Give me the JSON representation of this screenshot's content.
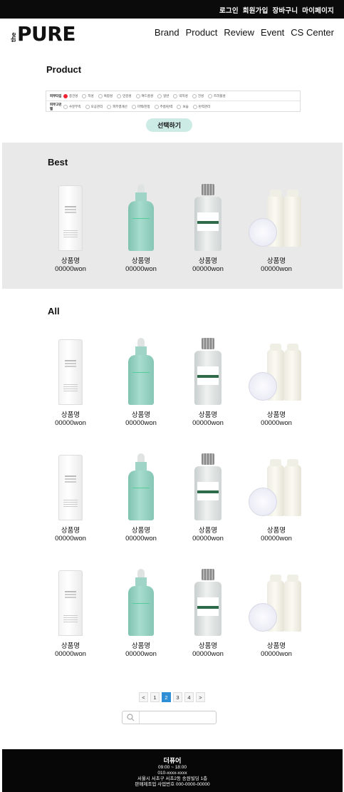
{
  "topbar": {
    "links": [
      "로그인",
      "회원가입",
      "장바구니",
      "마이페이지"
    ]
  },
  "logo": {
    "prefix": "the",
    "name": "PURE"
  },
  "nav": [
    "Brand",
    "Product",
    "Review",
    "Event",
    "CS Center"
  ],
  "product_section": {
    "title": "Product"
  },
  "filter": {
    "row1": {
      "label": "피부타입",
      "options": [
        "중건성",
        "지성",
        "복합성",
        "민감성",
        "여드름성",
        "일반",
        "약지성",
        "건성",
        "트러블성"
      ],
      "selected_index": 0
    },
    "row2": {
      "label": "피부고민별",
      "options": [
        "수분부족",
        "모공관리",
        "피부결개선",
        "미백/진정",
        "주름/탄력",
        "보습",
        "탄력관리"
      ]
    }
  },
  "select_button": "선택하기",
  "best": {
    "title": "Best",
    "items": [
      {
        "image": "tube-icon",
        "name": "상품명",
        "price": "00000won"
      },
      {
        "image": "serum-bottle-icon",
        "name": "상품명",
        "price": "00000won"
      },
      {
        "image": "toner-bottle-icon",
        "name": "상품명",
        "price": "00000won"
      },
      {
        "image": "duo-bottle-icon",
        "name": "상품명",
        "price": "00000won"
      }
    ]
  },
  "all": {
    "title": "All",
    "rows": [
      [
        {
          "image": "tube-icon",
          "name": "상품명",
          "price": "00000won"
        },
        {
          "image": "serum-bottle-icon",
          "name": "상품명",
          "price": "00000won"
        },
        {
          "image": "toner-bottle-icon",
          "name": "상품명",
          "price": "00000won"
        },
        {
          "image": "duo-bottle-icon",
          "name": "상품명",
          "price": "00000won"
        }
      ],
      [
        {
          "image": "tube-icon",
          "name": "상품명",
          "price": "00000won"
        },
        {
          "image": "serum-bottle-icon",
          "name": "상품명",
          "price": "00000won"
        },
        {
          "image": "toner-bottle-icon",
          "name": "상품명",
          "price": "00000won"
        },
        {
          "image": "duo-bottle-icon",
          "name": "상품명",
          "price": "00000won"
        }
      ],
      [
        {
          "image": "tube-icon",
          "name": "상품명",
          "price": "00000won"
        },
        {
          "image": "serum-bottle-icon",
          "name": "상품명",
          "price": "00000won"
        },
        {
          "image": "toner-bottle-icon",
          "name": "상품명",
          "price": "00000won"
        },
        {
          "image": "duo-bottle-icon",
          "name": "상품명",
          "price": "00000won"
        }
      ]
    ]
  },
  "pagination": {
    "prev": "<",
    "pages": [
      "1",
      "2",
      "3",
      "4"
    ],
    "current": "2",
    "next": ">"
  },
  "search": {
    "placeholder": "",
    "icon": "search-icon"
  },
  "footer": {
    "brand": "더퓨어",
    "hours": "09:00 ~ 18:00",
    "phone": "010-xxxx-xxxx",
    "address": "서울시 서초구 서초2동 송원빌딩 1층",
    "business": "판매제조업 사업번호 000-0000-00000"
  },
  "colors": {
    "accent": "#cdebe5",
    "active_page": "#2f8fd6",
    "band": "#e9e9e9",
    "header": "#0b0b0b"
  }
}
